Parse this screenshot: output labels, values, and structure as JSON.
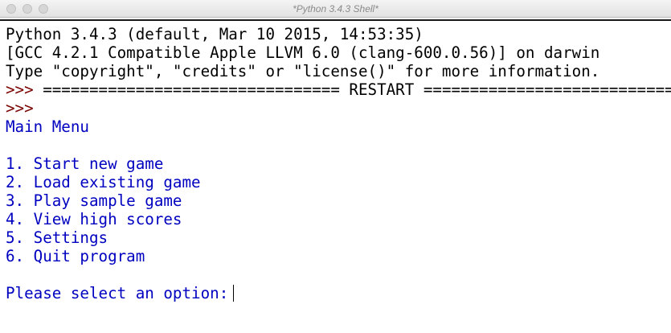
{
  "window": {
    "title": "*Python 3.4.3 Shell*"
  },
  "shell": {
    "banner": [
      "Python 3.4.3 (default, Mar 10 2015, 14:53:35)",
      "[GCC 4.2.1 Compatible Apple LLVM 6.0 (clang-600.0.56)] on darwin",
      "Type \"copyright\", \"credits\" or \"license()\" for more information."
    ],
    "prompt": ">>>",
    "restart_line": " ================================ RESTART ================================",
    "menu_title": "Main Menu",
    "menu_items": [
      "1. Start new game",
      "2. Load existing game",
      "3. Play sample game",
      "4. View high scores",
      "5. Settings",
      "6. Quit program"
    ],
    "input_prompt": "Please select an option:",
    "input_value": ""
  }
}
